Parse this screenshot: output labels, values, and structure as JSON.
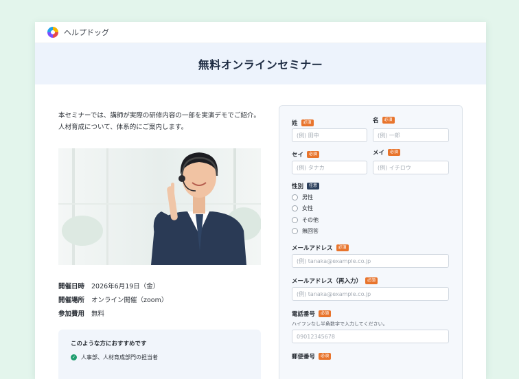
{
  "brand": {
    "name": "ヘルプドッグ"
  },
  "hero": {
    "title": "無料オンラインセミナー"
  },
  "intro": "本セミナーでは、講師が実際の研修内容の一部を実演デモでご紹介。人材育成について、体系的にご案内します。",
  "info": [
    {
      "key": "開催日時",
      "value": "2026年6月19日（金）"
    },
    {
      "key": "開催場所",
      "value": "オンライン開催（zoom）"
    },
    {
      "key": "参加費用",
      "value": "無料"
    }
  ],
  "recommend": {
    "title": "このような方におすすめです",
    "items": [
      "人事部、人材育成部門の担当者"
    ]
  },
  "form": {
    "required_badge": "必須",
    "optional_badge": "任意",
    "sei_label": "姓",
    "sei_placeholder": "(例) 田中",
    "mei_label": "名",
    "mei_placeholder": "(例) 一郎",
    "sei_kana_label": "セイ",
    "sei_kana_placeholder": "(例) タナカ",
    "mei_kana_label": "メイ",
    "mei_kana_placeholder": "(例) イチロウ",
    "gender_label": "性別",
    "gender_options": [
      "男性",
      "女性",
      "その他",
      "無回答"
    ],
    "email_label": "メールアドレス",
    "email_placeholder": "(例) tanaka@example.co.jp",
    "email_confirm_label": "メールアドレス（再入力）",
    "email_confirm_placeholder": "(例) tanaka@example.co.jp",
    "phone_label": "電話番号",
    "phone_hint": "ハイフンなし半角数字で入力してください。",
    "phone_placeholder": "09012345678",
    "zip_label": "郵便番号"
  }
}
